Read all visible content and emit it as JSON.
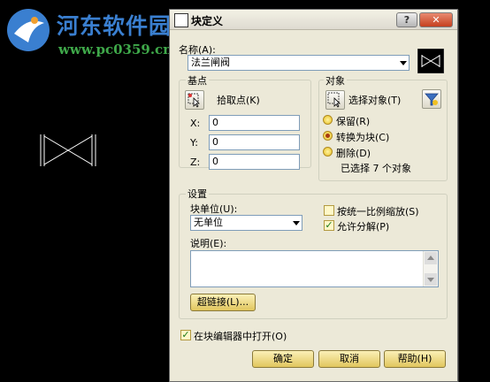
{
  "watermark": {
    "title": "河东软件园",
    "url": "www.pc0359.cn"
  },
  "dialog": {
    "title": "块定义",
    "help_button": "?",
    "close_button": "✕",
    "name": {
      "label": "名称(A):",
      "value": "法兰闸阀"
    },
    "base_point": {
      "group_title": "基点",
      "pick_label": "拾取点(K)",
      "x_label": "X:",
      "x_value": "0",
      "y_label": "Y:",
      "y_value": "0",
      "z_label": "Z:",
      "z_value": "0"
    },
    "objects": {
      "group_title": "对象",
      "select_label": "选择对象(T)",
      "options": {
        "retain": "保留(R)",
        "convert": "转换为块(C)",
        "delete": "删除(D)"
      },
      "selected_option": "convert",
      "status": "已选择 7 个对象"
    },
    "settings": {
      "group_title": "设置",
      "unit_label": "块单位(U):",
      "unit_value": "无单位",
      "scale_uniform_label": "按统一比例缩放(S)",
      "scale_uniform_checked": false,
      "allow_explode_label": "允许分解(P)",
      "allow_explode_checked": true,
      "description_label": "说明(E):",
      "description_value": "",
      "hyperlink_button": "超链接(L)..."
    },
    "open_in_editor_label": "在块编辑器中打开(O)",
    "open_in_editor_checked": true,
    "buttons": {
      "ok": "确定",
      "cancel": "取消",
      "help": "帮助(H)"
    }
  },
  "colors": {
    "dialog_bg": "#ece9d8",
    "button_gold": "#e1c65e",
    "watermark_blue": "#3a7fd0",
    "watermark_green": "#3fa94a",
    "canvas_bg": "#000000"
  }
}
